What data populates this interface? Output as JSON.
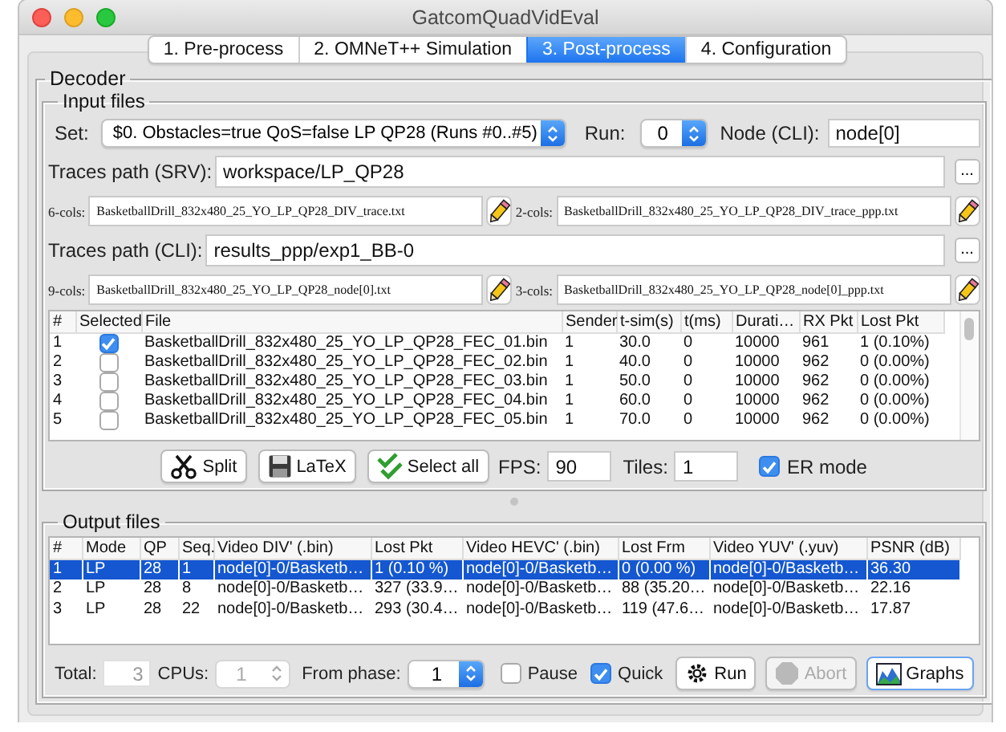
{
  "window": {
    "title": "GatcomQuadVidEval"
  },
  "tabs": [
    {
      "label": "1. Pre-process",
      "selected": false
    },
    {
      "label": "2. OMNeT++ Simulation",
      "selected": false
    },
    {
      "label": "3. Post-process",
      "selected": true
    },
    {
      "label": "4. Configuration",
      "selected": false
    }
  ],
  "decoder": {
    "title": "Decoder",
    "input_files": {
      "title": "Input files",
      "set": {
        "label": "Set:",
        "value": "$0. Obstacles=true QoS=false LP QP28 (Runs #0..#5)"
      },
      "run": {
        "label": "Run:",
        "value": "0"
      },
      "node": {
        "label": "Node (CLI):",
        "value": "node[0]"
      },
      "traces_srv": {
        "label": "Traces path (SRV):",
        "value": "workspace/LP_QP28",
        "browse": "..."
      },
      "srv_files": [
        {
          "label": "6-cols:",
          "value": "BasketballDrill_832x480_25_YO_LP_QP28_DIV_trace.txt"
        },
        {
          "label": "2-cols:",
          "value": "BasketballDrill_832x480_25_YO_LP_QP28_DIV_trace_ppp.txt"
        }
      ],
      "traces_cli": {
        "label": "Traces path (CLI):",
        "value": "results_ppp/exp1_BB-0",
        "browse": "..."
      },
      "cli_files": [
        {
          "label": "9-cols:",
          "value": "BasketballDrill_832x480_25_YO_LP_QP28_node[0].txt"
        },
        {
          "label": "3-cols:",
          "value": "BasketballDrill_832x480_25_YO_LP_QP28_node[0]_ppp.txt"
        }
      ],
      "table": {
        "columns": [
          {
            "label": "#",
            "kind": "text"
          },
          {
            "label": "Selected",
            "kind": "checkbox"
          },
          {
            "label": "File",
            "kind": "text"
          },
          {
            "label": "Sender",
            "kind": "text"
          },
          {
            "label": "t-sim(s)",
            "kind": "text"
          },
          {
            "label": "t(ms)",
            "kind": "text"
          },
          {
            "label": "Durati…",
            "kind": "text"
          },
          {
            "label": "RX Pkt",
            "kind": "text"
          },
          {
            "label": "Lost Pkt",
            "kind": "text"
          }
        ],
        "rows": [
          {
            "checked": true,
            "cells": [
              "1",
              "",
              "BasketballDrill_832x480_25_YO_LP_QP28_FEC_01.bin",
              "1",
              "30.0",
              "0",
              "10000",
              "961",
              "1 (0.10%)"
            ]
          },
          {
            "checked": false,
            "cells": [
              "2",
              "",
              "BasketballDrill_832x480_25_YO_LP_QP28_FEC_02.bin",
              "1",
              "40.0",
              "0",
              "10000",
              "962",
              "0 (0.00%)"
            ]
          },
          {
            "checked": false,
            "cells": [
              "3",
              "",
              "BasketballDrill_832x480_25_YO_LP_QP28_FEC_03.bin",
              "1",
              "50.0",
              "0",
              "10000",
              "962",
              "0 (0.00%)"
            ]
          },
          {
            "checked": false,
            "cells": [
              "4",
              "",
              "BasketballDrill_832x480_25_YO_LP_QP28_FEC_04.bin",
              "1",
              "60.0",
              "0",
              "10000",
              "962",
              "0 (0.00%)"
            ]
          },
          {
            "checked": false,
            "cells": [
              "5",
              "",
              "BasketballDrill_832x480_25_YO_LP_QP28_FEC_05.bin",
              "1",
              "70.0",
              "0",
              "10000",
              "962",
              "0 (0.00%)"
            ]
          }
        ]
      },
      "buttons": [
        {
          "label": "Split",
          "kind": "split"
        },
        {
          "label": "LaTeX",
          "kind": "latex"
        },
        {
          "label": "Select all",
          "kind": "select_all"
        }
      ],
      "fps": {
        "label": "FPS:",
        "value": "90"
      },
      "tiles": {
        "label": "Tiles:",
        "value": "1"
      },
      "er_mode": {
        "label": "ER mode",
        "checked": true
      }
    },
    "output_files": {
      "title": "Output files",
      "table": {
        "columns": [
          "#",
          "Mode",
          "QP",
          "Seq.",
          "Video DIV' (.bin)",
          "Lost Pkt",
          "Video HEVC' (.bin)",
          "Lost Frm",
          "Video YUV' (.yuv)",
          "PSNR (dB)"
        ],
        "rows": [
          {
            "selected": true,
            "cells": [
              "1",
              "LP",
              "28",
              "1",
              "node[0]-0/Basketb…",
              "1 (0.10 %)",
              "node[0]-0/Basketb…",
              "0 (0.00 %)",
              "node[0]-0/Basketb…",
              "36.30"
            ]
          },
          {
            "selected": false,
            "cells": [
              "2",
              "LP",
              "28",
              "8",
              "node[0]-0/Basketb…",
              "327 (33.9…",
              "node[0]-0/Basketb…",
              "88 (35.20…",
              "node[0]-0/Basketb…",
              "22.16"
            ]
          },
          {
            "selected": false,
            "cells": [
              "3",
              "LP",
              "28",
              "22",
              "node[0]-0/Basketb…",
              "293 (30.4…",
              "node[0]-0/Basketb…",
              "119 (47.6…",
              "node[0]-0/Basketb…",
              "17.87"
            ]
          }
        ]
      },
      "total": {
        "label": "Total:",
        "value": "3",
        "disabled": true
      },
      "cpus": {
        "label": "CPUs:",
        "value": "1",
        "disabled": true
      },
      "from_phase": {
        "label": "From phase:",
        "value": "1"
      },
      "pause": {
        "label": "Pause",
        "checked": false
      },
      "quick": {
        "label": "Quick",
        "checked": true
      },
      "buttons": [
        {
          "label": "Run",
          "kind": "run",
          "disabled": false
        },
        {
          "label": "Abort",
          "kind": "abort",
          "disabled": true
        },
        {
          "label": "Graphs",
          "kind": "graphs",
          "disabled": false
        }
      ]
    }
  }
}
